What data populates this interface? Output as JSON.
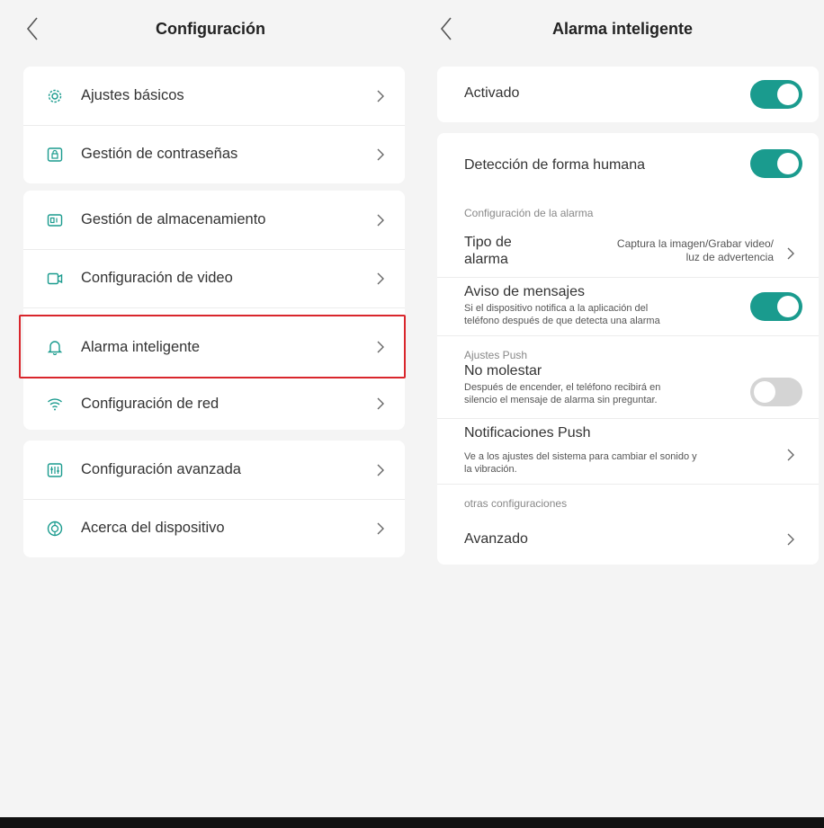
{
  "left": {
    "title": "Configuración",
    "items": [
      {
        "label": "Ajustes básicos",
        "icon": "gear-icon"
      },
      {
        "label": "Gestión de contraseñas",
        "icon": "lock-icon"
      },
      {
        "label": "Gestión de almacenamiento",
        "icon": "storage-icon"
      },
      {
        "label": "Configuración de video",
        "icon": "video-icon"
      },
      {
        "label": "Alarma inteligente",
        "icon": "bell-icon"
      },
      {
        "label": "Configuración de red",
        "icon": "wifi-icon"
      },
      {
        "label": "Configuración avanzada",
        "icon": "sliders-icon"
      },
      {
        "label": "Acerca del dispositivo",
        "icon": "info-icon"
      }
    ],
    "highlighted_item": "Alarma inteligente"
  },
  "right": {
    "title": "Alarma inteligente",
    "activated": {
      "label": "Activado",
      "on": true
    },
    "human_detection": {
      "label": "Detección de forma humana",
      "on": true
    },
    "alarm_config_section": "Configuración de la alarma",
    "alarm_type": {
      "label_line1": "Tipo de",
      "label_line2": "alarma",
      "value_line1": "Captura la imagen/Grabar video/",
      "value_line2": "luz de advertencia"
    },
    "message_notice": {
      "label": "Aviso de mensajes",
      "desc_line1": "Si el dispositivo notifica a la aplicación del",
      "desc_line2": "teléfono después de que detecta una alarma",
      "on": true
    },
    "push_section": "Ajustes Push",
    "do_not_disturb": {
      "label": "No molestar",
      "desc_line1": "Después de encender, el teléfono recibirá en",
      "desc_line2": "silencio el mensaje de alarma sin preguntar.",
      "on": false
    },
    "push_notifications": {
      "label": "Notificaciones Push",
      "desc_line1": "Ve a los ajustes del sistema para cambiar el sonido y",
      "desc_line2": "la vibración."
    },
    "other_section": "otras configuraciones",
    "advanced": {
      "label": "Avanzado"
    }
  },
  "colors": {
    "accent": "#1a9b8e",
    "highlight": "#d9262c",
    "background": "#f4f4f4"
  }
}
